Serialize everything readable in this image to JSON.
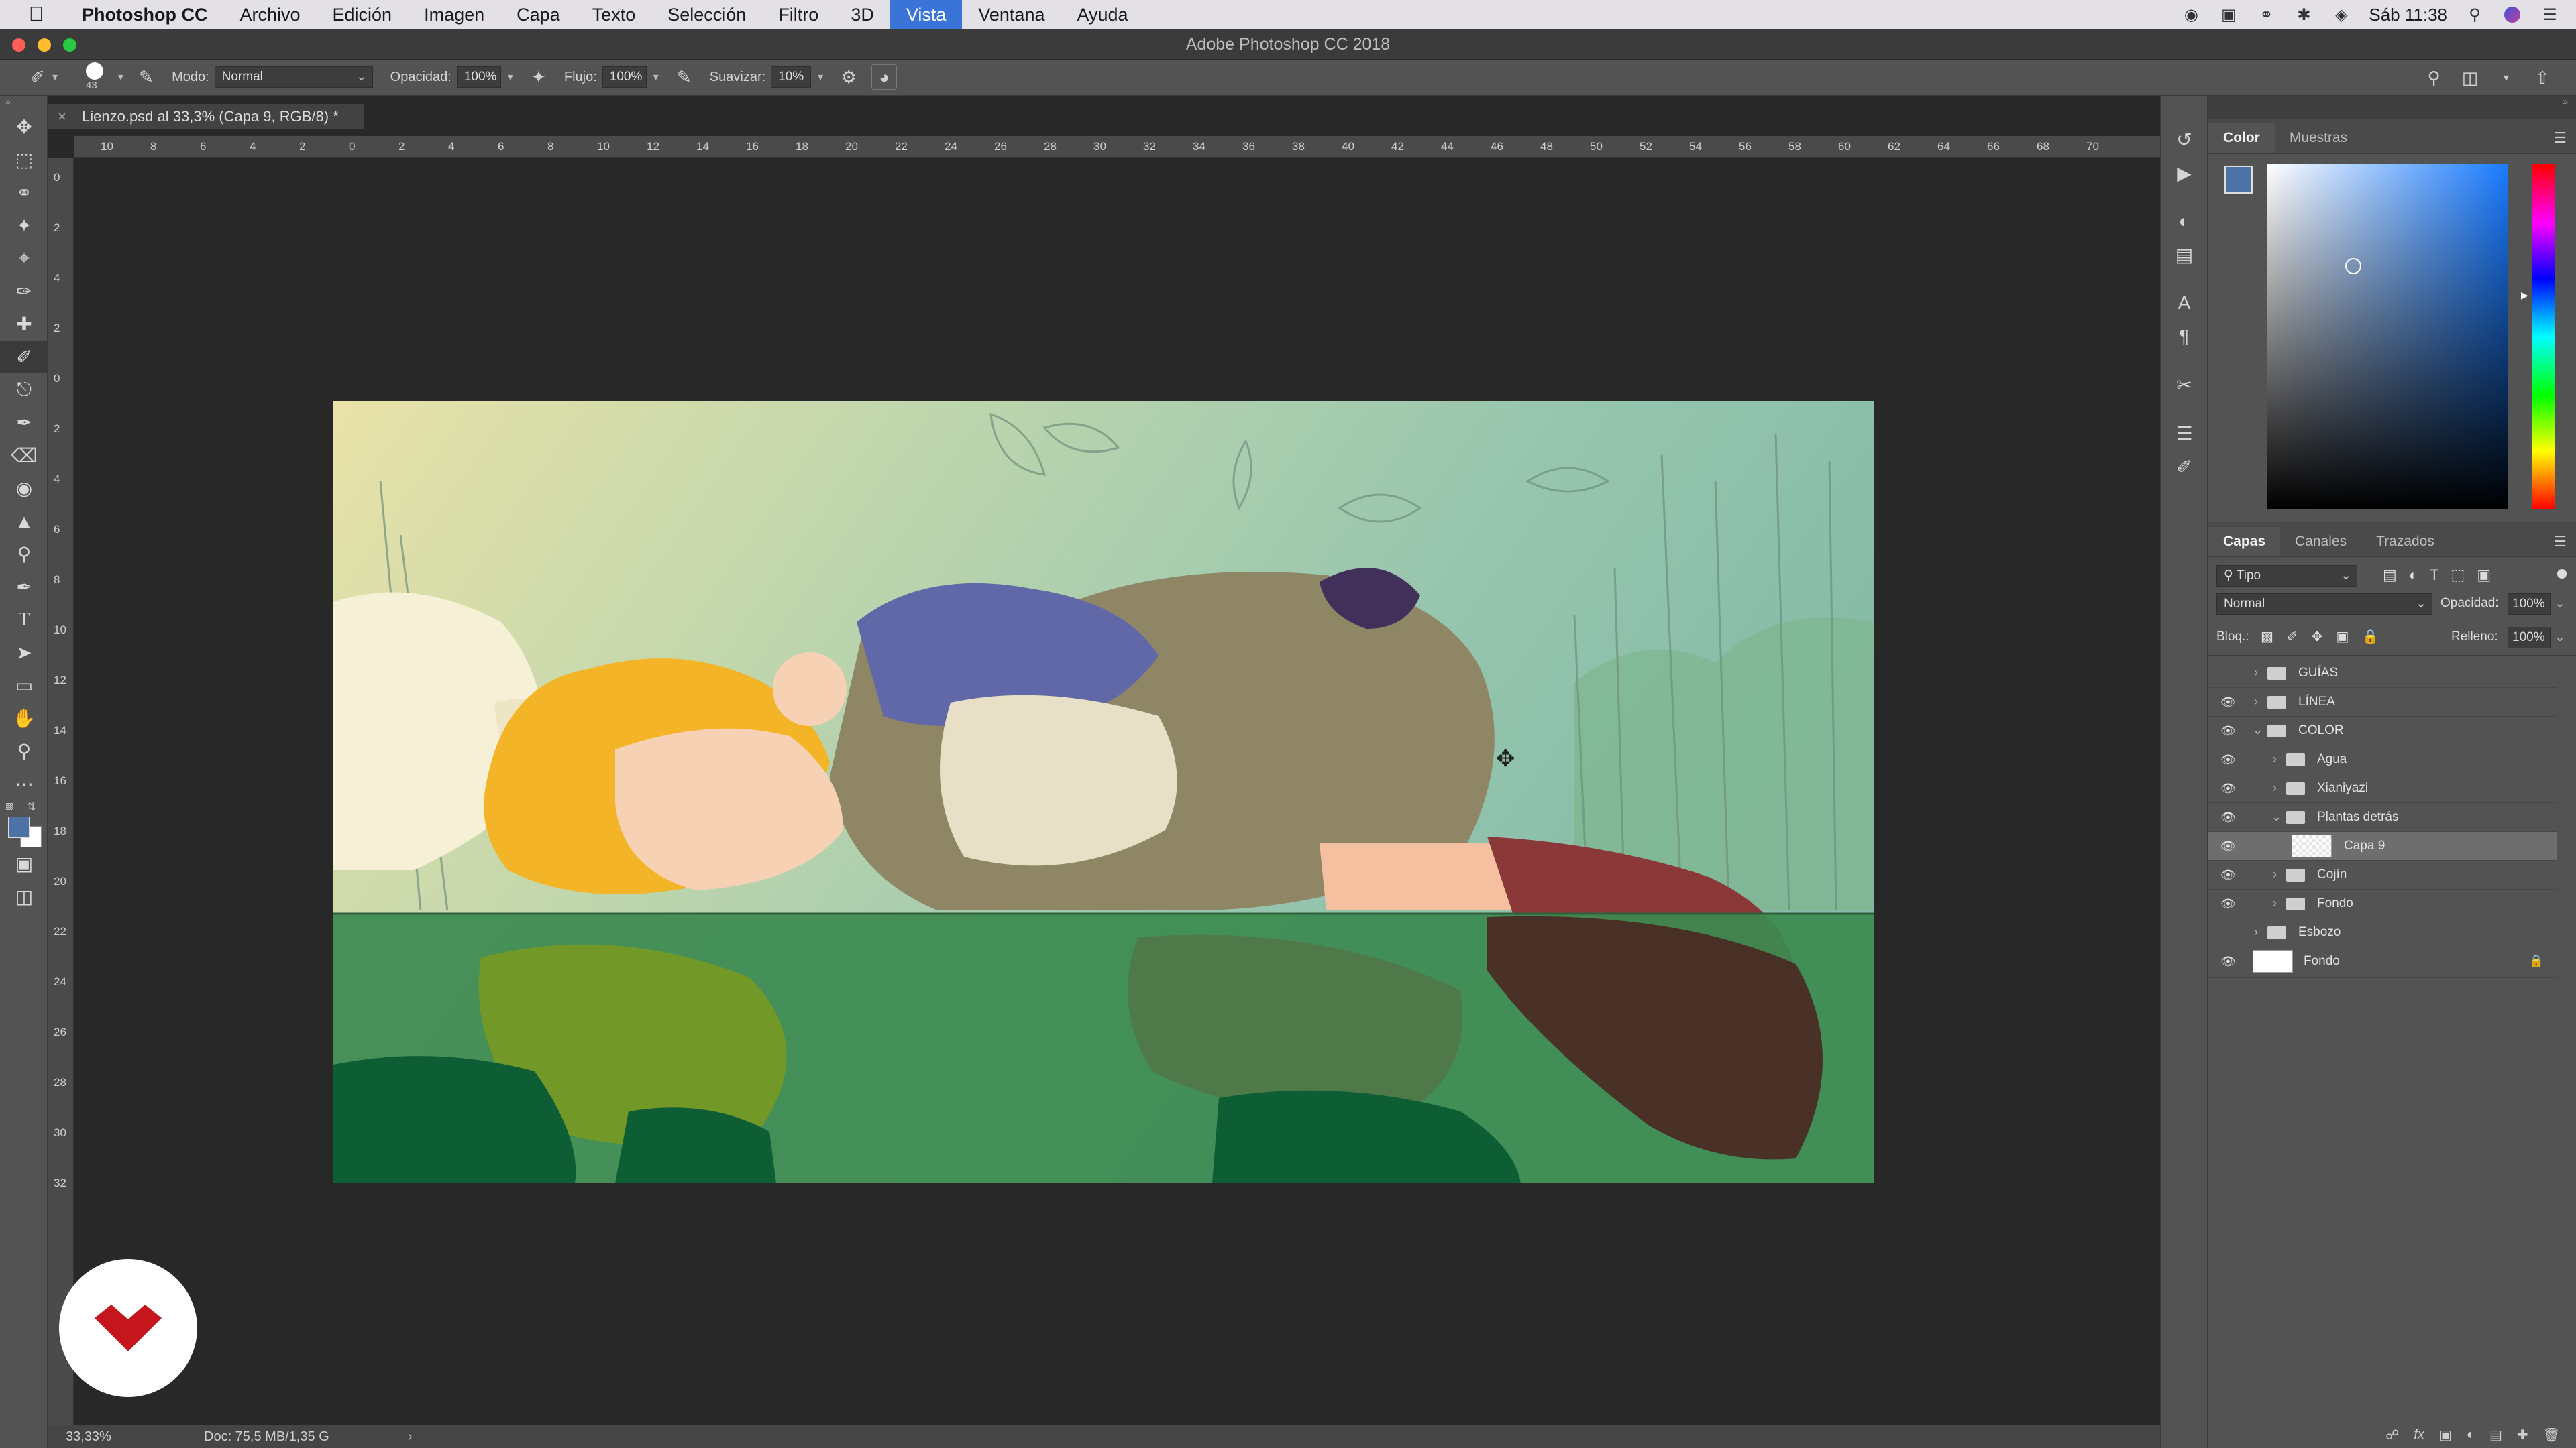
{
  "menubar": {
    "app_name": "Photoshop CC",
    "menus": [
      "Archivo",
      "Edición",
      "Imagen",
      "Capa",
      "Texto",
      "Selección",
      "Filtro",
      "3D",
      "Vista",
      "Ventana",
      "Ayuda"
    ],
    "active_menu": "Vista",
    "clock": "Sáb 11:38"
  },
  "window": {
    "title": "Adobe Photoshop CC 2018"
  },
  "options_bar": {
    "brush_size": "43",
    "mode_label": "Modo:",
    "mode_value": "Normal",
    "opacity_label": "Opacidad:",
    "opacity_value": "100%",
    "flow_label": "Flujo:",
    "flow_value": "100%",
    "smoothing_label": "Suavizar:",
    "smoothing_value": "10%"
  },
  "document": {
    "tab_title": "Lienzo.psd al 33,3% (Capa 9, RGB/8) *",
    "ruler_h": [
      "10",
      "8",
      "6",
      "4",
      "2",
      "0",
      "2",
      "4",
      "6",
      "8",
      "10",
      "12",
      "14",
      "16",
      "18",
      "20",
      "22",
      "24",
      "26",
      "28",
      "30",
      "32",
      "34",
      "36",
      "38",
      "40",
      "42",
      "44",
      "46",
      "48",
      "50",
      "52",
      "54",
      "56",
      "58",
      "60",
      "62",
      "64",
      "66",
      "68",
      "70"
    ],
    "ruler_v": [
      "0",
      "2",
      "4",
      "2",
      "0",
      "2",
      "4",
      "6",
      "8",
      "10",
      "12",
      "14",
      "16",
      "18",
      "20",
      "22",
      "24",
      "26",
      "28",
      "30",
      "32"
    ],
    "zoom": "33,33%",
    "doc_size": "Doc: 75,5 MB/1,35 G"
  },
  "color_panel": {
    "tabs": [
      "Color",
      "Muestras"
    ],
    "active_tab": "Color",
    "foreground_color": "#4f72a6"
  },
  "layers_panel": {
    "tabs": [
      "Capas",
      "Canales",
      "Trazados"
    ],
    "active_tab": "Capas",
    "filter_kind": "Tipo",
    "blend_mode": "Normal",
    "opacity_label": "Opacidad:",
    "opacity_value": "100%",
    "lock_label": "Bloq.:",
    "fill_label": "Relleno:",
    "fill_value": "100%",
    "layers": [
      {
        "name": "GUÍAS",
        "type": "group",
        "visible": false,
        "indent": 0,
        "expanded": false
      },
      {
        "name": "LÍNEA",
        "type": "group",
        "visible": true,
        "indent": 0,
        "expanded": false
      },
      {
        "name": "COLOR",
        "type": "group",
        "visible": true,
        "indent": 0,
        "expanded": true
      },
      {
        "name": "Agua",
        "type": "group",
        "visible": true,
        "indent": 1,
        "expanded": false
      },
      {
        "name": "Xianiyazi",
        "type": "group",
        "visible": true,
        "indent": 1,
        "expanded": false
      },
      {
        "name": "Plantas detrás",
        "type": "group",
        "visible": true,
        "indent": 1,
        "expanded": true
      },
      {
        "name": "Capa 9",
        "type": "layer",
        "visible": true,
        "indent": 2,
        "selected": true
      },
      {
        "name": "Cojín",
        "type": "group",
        "visible": true,
        "indent": 1,
        "expanded": false
      },
      {
        "name": "Fondo",
        "type": "group",
        "visible": true,
        "indent": 1,
        "expanded": false
      },
      {
        "name": "Esbozo",
        "type": "group",
        "visible": false,
        "indent": 0,
        "expanded": false
      },
      {
        "name": "Fondo",
        "type": "background",
        "visible": true,
        "indent": 0,
        "locked": true
      }
    ]
  }
}
